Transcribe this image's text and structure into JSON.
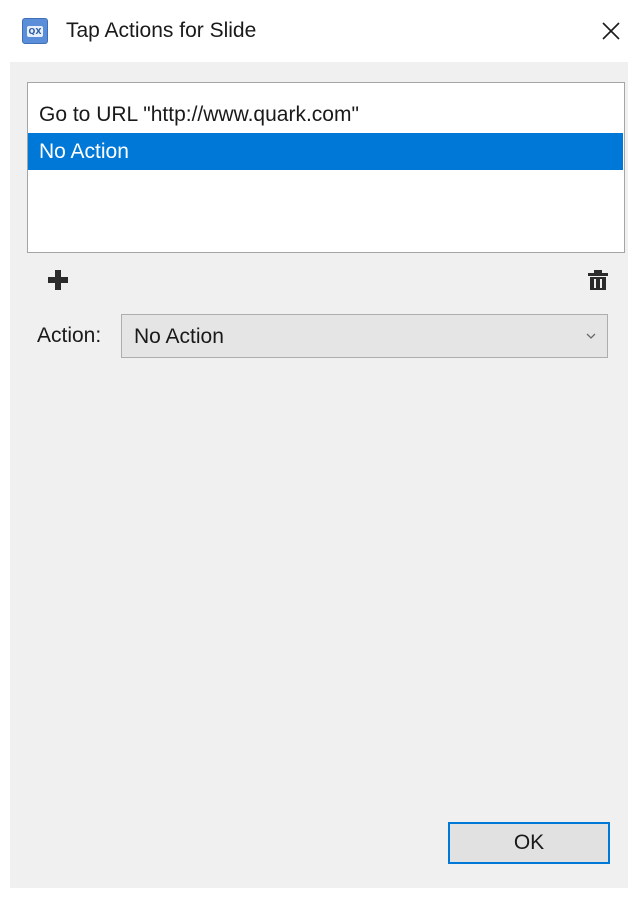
{
  "window": {
    "title": "Tap Actions for Slide",
    "app_icon": "quark-app-icon",
    "app_icon_text": "QX",
    "close_icon": "close-icon"
  },
  "actions_list": {
    "items": [
      {
        "label": "Go to URL \"http://www.quark.com\"",
        "selected": false
      },
      {
        "label": "No Action",
        "selected": true
      }
    ]
  },
  "toolbar": {
    "add_icon": "plus-icon",
    "delete_icon": "trash-icon"
  },
  "action_field": {
    "label": "Action:",
    "value": "No Action",
    "dropdown_icon": "chevron-down-icon"
  },
  "footer": {
    "ok_label": "OK"
  },
  "colors": {
    "selection": "#0078d7",
    "panel_background": "#f0f0f0",
    "app_icon": "#5b8ed8"
  }
}
